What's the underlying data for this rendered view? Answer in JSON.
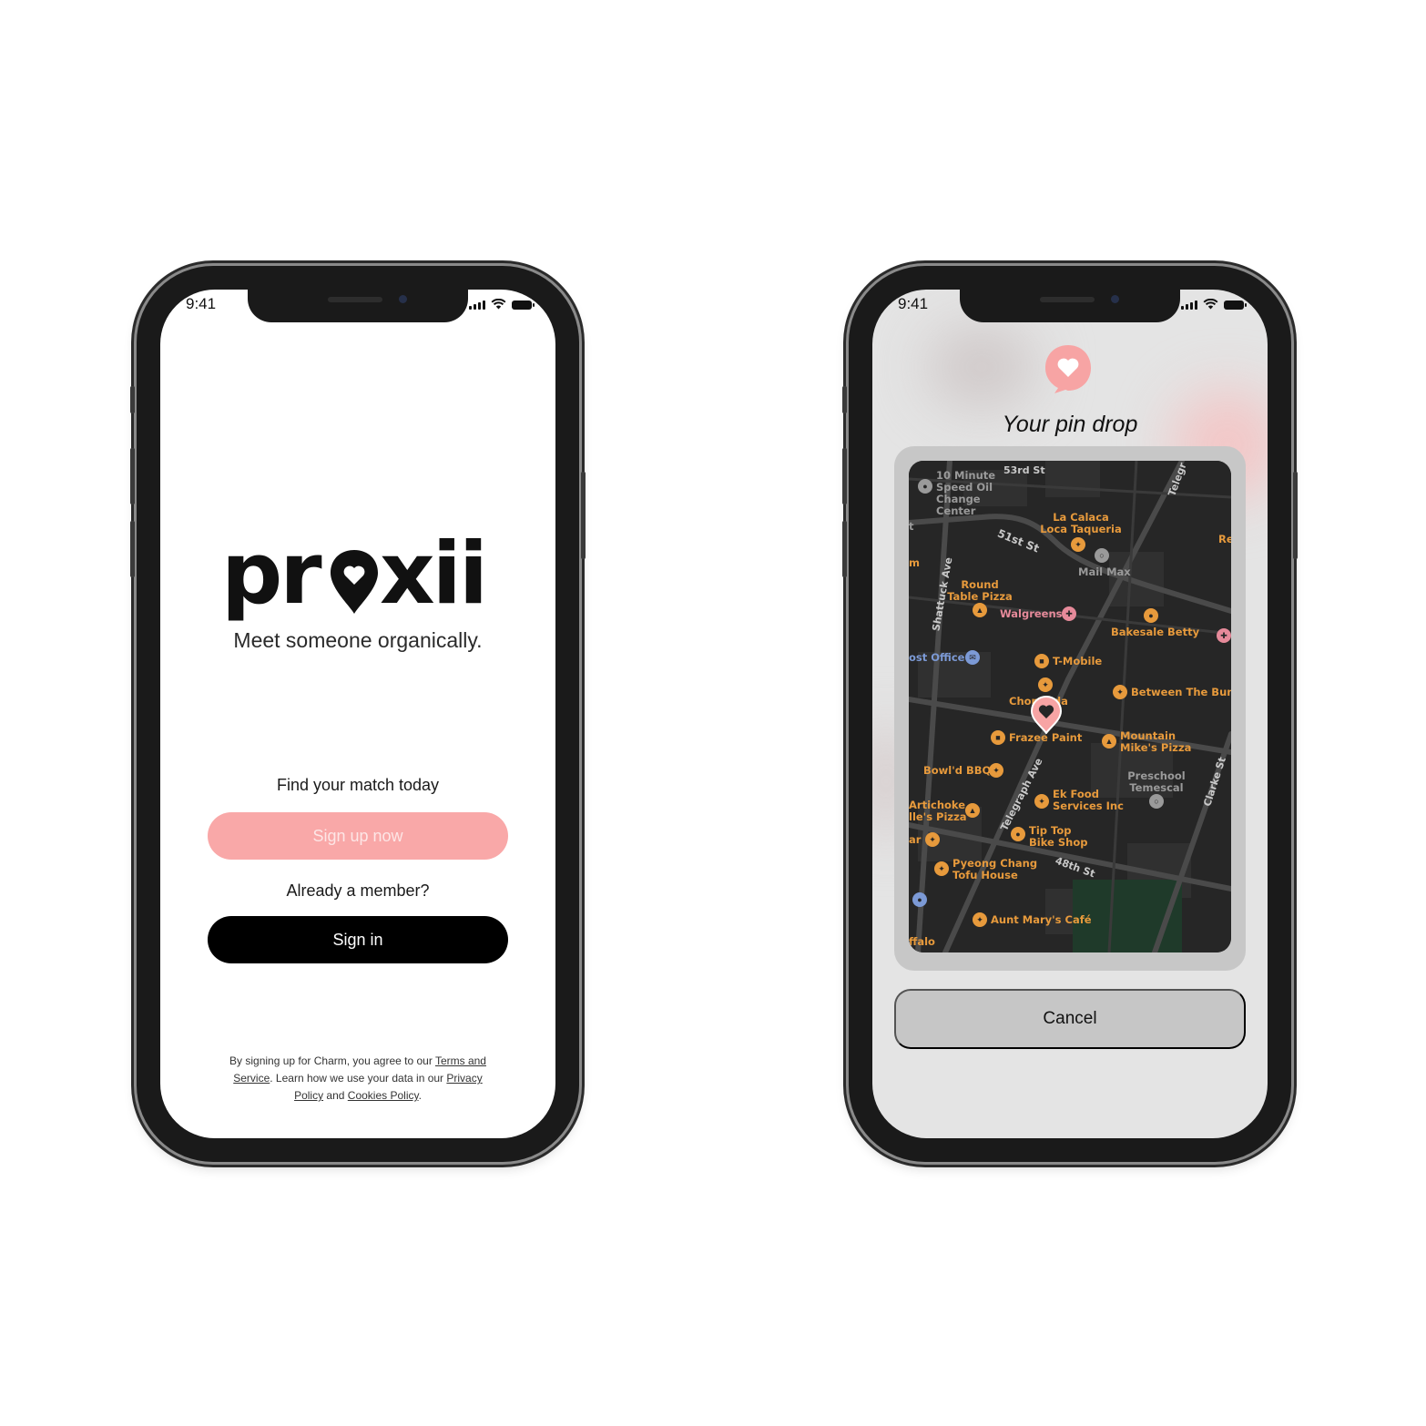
{
  "colors": {
    "brand_pink": "#f9a8a8",
    "map_bg": "#262626",
    "poi_orange": "#e79a3c"
  },
  "left_phone": {
    "status": {
      "time": "9:41"
    },
    "logo": {
      "text": "proxii"
    },
    "tagline": "Meet someone organically.",
    "find_label": "Find your match today",
    "signup_label": "Sign up now",
    "member_label": "Already a member?",
    "signin_label": "Sign in",
    "legal": {
      "part1": "By signing up for Charm, you agree to our ",
      "terms": "Terms and Service",
      "part2": ". Learn how we use your data in our ",
      "privacy": "Privacy Policy",
      "and": " and ",
      "cookies": "Cookies Policy",
      "end": "."
    }
  },
  "right_phone": {
    "status": {
      "time": "9:41"
    },
    "title": "Your pin drop",
    "cancel_label": "Cancel",
    "map": {
      "streets": [
        "53rd St",
        "51st St",
        "Shattuck Ave",
        "Telegraph Ave",
        "Telegr",
        "48th St",
        "Clarke St"
      ],
      "places": [
        {
          "name": "10 Minute Speed Oil Change Center",
          "icon": "car-service-icon"
        },
        {
          "name": "La Calaca Loca Taqueria",
          "icon": "restaurant-icon"
        },
        {
          "name": "Mail Max",
          "icon": "pin-icon"
        },
        {
          "name": "Round Table Pizza",
          "icon": "pizza-icon"
        },
        {
          "name": "Walgreens",
          "icon": "pharmacy-icon"
        },
        {
          "name": "Bakesale Betty",
          "icon": "bakery-icon"
        },
        {
          "name": "ost Office",
          "icon": "mail-icon"
        },
        {
          "name": "T-Mobile",
          "icon": "shop-icon"
        },
        {
          "name": "Chop inda",
          "icon": "restaurant-icon"
        },
        {
          "name": "Between The Bun",
          "icon": "restaurant-icon"
        },
        {
          "name": "Frazee Paint",
          "icon": "shop-icon"
        },
        {
          "name": "Mountain Mike's Pizza",
          "icon": "pizza-icon"
        },
        {
          "name": "Bowl'd BBQ",
          "icon": "restaurant-icon"
        },
        {
          "name": "Preschool Temescal",
          "icon": "pin-icon"
        },
        {
          "name": "Ek Food Services Inc",
          "icon": "restaurant-icon"
        },
        {
          "name": "Artichoke lle's Pizza",
          "icon": "pizza-icon"
        },
        {
          "name": "Tip Top Bike Shop",
          "icon": "bike-icon"
        },
        {
          "name": "Pyeong Chang Tofu House",
          "icon": "restaurant-icon"
        },
        {
          "name": "Aunt Mary's Café",
          "icon": "restaurant-icon"
        },
        {
          "name": "ffalo",
          "icon": ""
        },
        {
          "name": "Re",
          "icon": ""
        },
        {
          "name": "m",
          "icon": ""
        },
        {
          "name": "ar",
          "icon": ""
        },
        {
          "name": "t",
          "icon": ""
        }
      ]
    }
  }
}
